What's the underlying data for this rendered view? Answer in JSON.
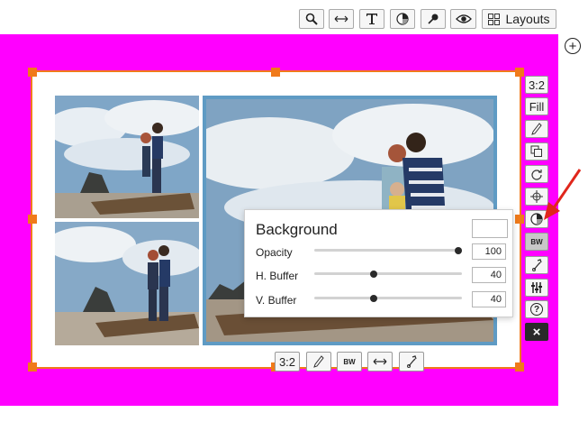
{
  "toolbar": {
    "icons": [
      "search-icon",
      "width-arrows-icon",
      "text-icon",
      "color-wheel-icon",
      "pin-icon",
      "eye-icon",
      "grid-icon"
    ],
    "layouts_label": "Layouts"
  },
  "side_toolbar": {
    "ratio_label": "3:2",
    "fill_label": "Fill",
    "bw_label": "BW",
    "help_glyph": "?",
    "close_glyph": "×"
  },
  "bottom_toolbar": {
    "ratio_label": "3:2",
    "bw_label": "BW"
  },
  "background_panel": {
    "title": "Background",
    "swatch_color": "#ffffff",
    "sliders": [
      {
        "label": "Opacity",
        "value": "100",
        "level": 1.0
      },
      {
        "label": "H. Buffer",
        "value": "40",
        "level": 0.4
      },
      {
        "label": "V. Buffer",
        "value": "40",
        "level": 0.4
      }
    ]
  },
  "colors": {
    "canvas": "#ff00ff",
    "selection": "#f07a1a",
    "photo_border": "#5f9bc4",
    "annotation_arrow": "#e0261b"
  }
}
